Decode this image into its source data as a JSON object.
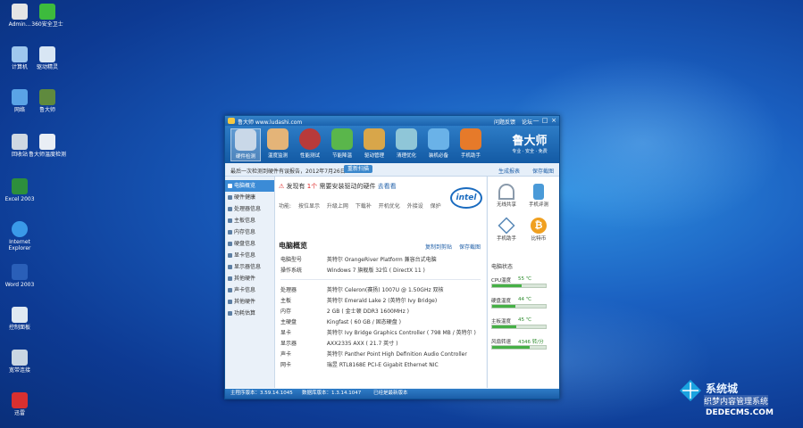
{
  "desktop": {
    "icons": [
      {
        "label": "Admin...",
        "icon": "folder-user-icon"
      },
      {
        "label": "360安全卫士",
        "icon": "shield-app-icon"
      },
      {
        "label": "计算机",
        "icon": "computer-icon"
      },
      {
        "label": "驱动精灵",
        "icon": "driver-app-icon"
      },
      {
        "label": "网络",
        "icon": "network-icon"
      },
      {
        "label": "鲁大师",
        "icon": "ludashi-icon"
      },
      {
        "label": "回收站",
        "icon": "recycle-bin-icon"
      },
      {
        "label": "鲁大师温度检测",
        "icon": "shortcut-icon"
      },
      {
        "label": "Excel 2003",
        "icon": "excel-icon"
      },
      {
        "label": "Internet Explorer",
        "icon": "ie-icon"
      },
      {
        "label": "Word 2003",
        "icon": "word-icon"
      },
      {
        "label": "控制面板",
        "icon": "control-panel-icon"
      },
      {
        "label": "宽带连接",
        "icon": "broadband-icon"
      },
      {
        "label": "迅雷",
        "icon": "app-red-icon"
      }
    ]
  },
  "window": {
    "title": "鲁大师 www.ludashi.com",
    "title_links": [
      "问题反馈",
      "论坛"
    ],
    "controls": [
      "—",
      "□",
      "×"
    ],
    "toolbar": [
      {
        "label": "硬件检测",
        "icon": "hardware-check-icon",
        "selected": true
      },
      {
        "label": "温度监测",
        "icon": "temperature-icon"
      },
      {
        "label": "性能测试",
        "icon": "performance-icon"
      },
      {
        "label": "节能降温",
        "icon": "energy-saving-icon"
      },
      {
        "label": "驱动管理",
        "icon": "driver-manage-icon"
      },
      {
        "label": "清理优化",
        "icon": "cleanup-icon"
      },
      {
        "label": "装机必备",
        "icon": "install-icon"
      },
      {
        "label": "手机助手",
        "icon": "phone-icon"
      }
    ],
    "brand": {
      "name": "鲁大师",
      "tagline": "专业 · 安全 · 免费"
    },
    "infobar": {
      "message": "最后一次检测到硬件有误报告，2012年7月26日",
      "button": "重新扫描",
      "right_links": [
        "生成报表",
        "保存截图"
      ]
    },
    "nav": [
      {
        "label": "电脑概览",
        "selected": true
      },
      {
        "label": "硬件健康"
      },
      {
        "label": "处理器信息"
      },
      {
        "label": "主板信息"
      },
      {
        "label": "内存信息"
      },
      {
        "label": "硬盘信息"
      },
      {
        "label": "显卡信息"
      },
      {
        "label": "显示器信息"
      },
      {
        "label": "其他硬件"
      },
      {
        "label": "声卡信息"
      },
      {
        "label": "其他硬件"
      },
      {
        "label": "功耗估算"
      }
    ],
    "main": {
      "alert_prefix": "发现有",
      "alert_count": "1个",
      "alert_suffix": "需要安装驱动的硬件",
      "alert_link": "去看看",
      "checks_label": "功能:",
      "checks": [
        "按位显示",
        "升级上网",
        "下载补",
        "开机优化",
        "外接设",
        "保护"
      ],
      "intel_logo": "intel",
      "overview_title": "电脑概览",
      "overview_links": [
        "复制到剪贴",
        "保存截图"
      ],
      "rows": [
        {
          "k": "电脑型号",
          "v": "英特尔 OrangeRiver Platform 兼容台式电脑"
        },
        {
          "k": "操作系统",
          "v": "Windows 7 旗舰版 32位 ( DirectX 11 )"
        },
        {
          "k": "处理器",
          "v": "英特尔 Celeron(赛扬) 1007U @ 1.50GHz 双核"
        },
        {
          "k": "主板",
          "v": "英特尔 Emerald Lake 2 (英特尔 Ivy Bridge)"
        },
        {
          "k": "内存",
          "v": "2 GB ( 金士顿 DDR3 1600MHz )"
        },
        {
          "k": "主硬盘",
          "v": "Kingfast ( 60 GB / 固态硬盘 )"
        },
        {
          "k": "显卡",
          "v": "英特尔 Ivy Bridge Graphics Controller ( 798 MB / 英特尔 )"
        },
        {
          "k": "显示器",
          "v": "AXX2335 AXX ( 21.7 英寸 )"
        },
        {
          "k": "声卡",
          "v": "英特尔 Panther Point High Definition Audio Controller"
        },
        {
          "k": "网卡",
          "v": "瑞昱 RTL8168E PCI-E Gigabit Ethernet NIC"
        }
      ]
    },
    "right": {
      "tiles": [
        {
          "label": "无线共享",
          "icon": "wifi-icon"
        },
        {
          "label": "手机评测",
          "icon": "phone-test-icon"
        },
        {
          "label": "手机助手",
          "icon": "phone-assist-icon"
        },
        {
          "label": "比特币",
          "icon": "bitcoin-icon"
        }
      ],
      "status_title": "电脑状态",
      "stats": [
        {
          "label": "CPU温度",
          "value": "55 ℃",
          "level": 0.55
        },
        {
          "label": "硬盘温度",
          "value": "44 ℃",
          "level": 0.44
        },
        {
          "label": "主板温度",
          "value": "45 ℃",
          "level": 0.45
        },
        {
          "label": "风扇转速",
          "value": "4346 转/分",
          "level": 0.7
        }
      ]
    },
    "statusbar": {
      "main_version": "主程序版本：3.59.14.1045",
      "data_version": "数据库版本：1.3.14.1047",
      "update": "已经是最新版本"
    }
  },
  "watermark": {
    "cn": "系统城",
    "line2": "织梦内容管理系统",
    "line3": "DEDECMS.COM"
  }
}
